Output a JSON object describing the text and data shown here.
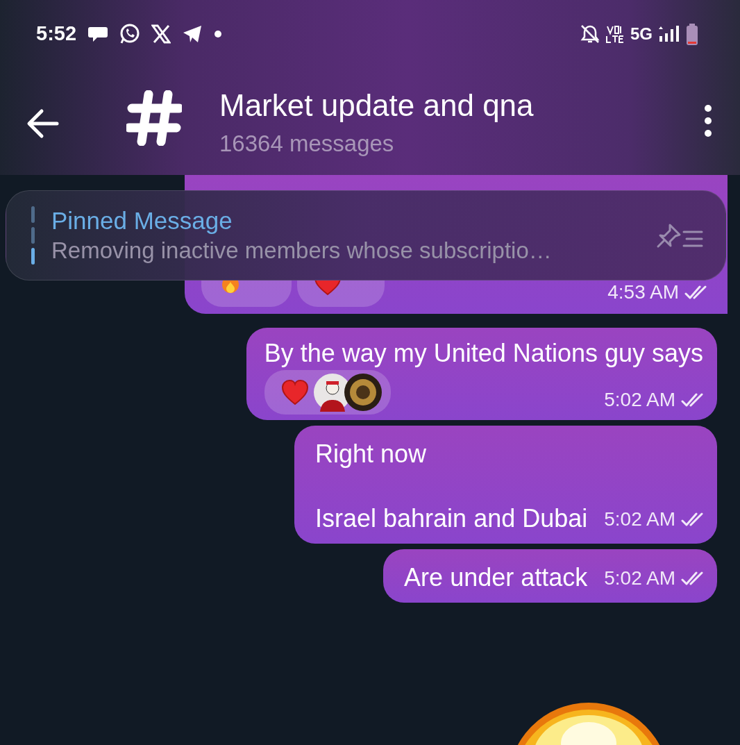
{
  "status_bar": {
    "time": "5:52",
    "network": "5G"
  },
  "header": {
    "title": "Market update and qna",
    "subtitle": "16364 messages"
  },
  "pinned": {
    "label": "Pinned Message",
    "text": "Removing inactive members whose subscriptio…"
  },
  "messages": [
    {
      "time": "4:53 AM",
      "reactions": [
        {
          "kind": "fire"
        },
        {
          "kind": "heart"
        }
      ]
    },
    {
      "text": "By the way my United Nations guy says",
      "time": "5:02 AM",
      "reactions": [
        {
          "kind": "heart-avatars"
        }
      ]
    },
    {
      "text": "Right now\n\nIsrael bahrain and Dubai",
      "time": "5:02 AM"
    },
    {
      "text": "Are under attack",
      "time": "5:02 AM"
    }
  ]
}
